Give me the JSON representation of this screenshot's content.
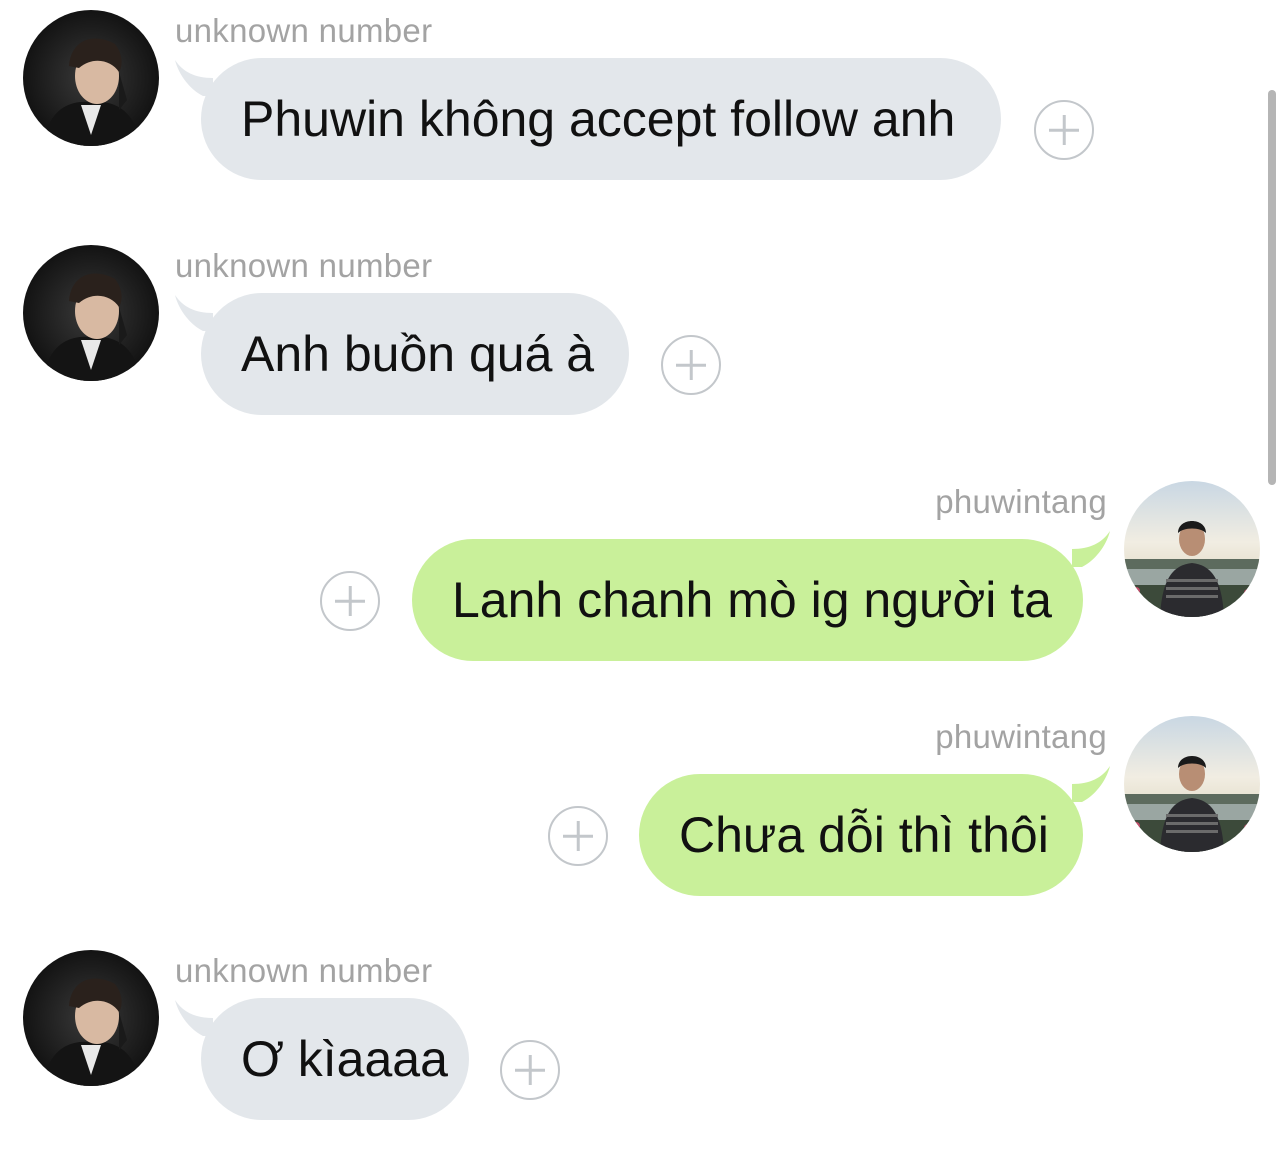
{
  "colors": {
    "incoming_bubble": "#e3e7eb",
    "outgoing_bubble": "#c9f09a",
    "sender_label": "#a3a3a3",
    "add_icon": "#c3c7cb"
  },
  "messages": [
    {
      "direction": "incoming",
      "sender": "unknown number",
      "text": "Phuwin không accept follow anh",
      "avatar_icon": "contact-avatar",
      "action_icon": "add-reaction-icon"
    },
    {
      "direction": "incoming",
      "sender": "unknown number",
      "text": "Anh buồn quá à",
      "avatar_icon": "contact-avatar",
      "action_icon": "add-reaction-icon"
    },
    {
      "direction": "outgoing",
      "sender": "phuwintang",
      "text": "Lanh chanh mò ig người ta",
      "avatar_icon": "user-avatar",
      "action_icon": "add-reaction-icon"
    },
    {
      "direction": "outgoing",
      "sender": "phuwintang",
      "text": "Chưa dỗi thì thôi",
      "avatar_icon": "user-avatar",
      "action_icon": "add-reaction-icon"
    },
    {
      "direction": "incoming",
      "sender": "unknown number",
      "text": "Ơ kìaaaa",
      "avatar_icon": "contact-avatar",
      "action_icon": "add-reaction-icon"
    }
  ]
}
